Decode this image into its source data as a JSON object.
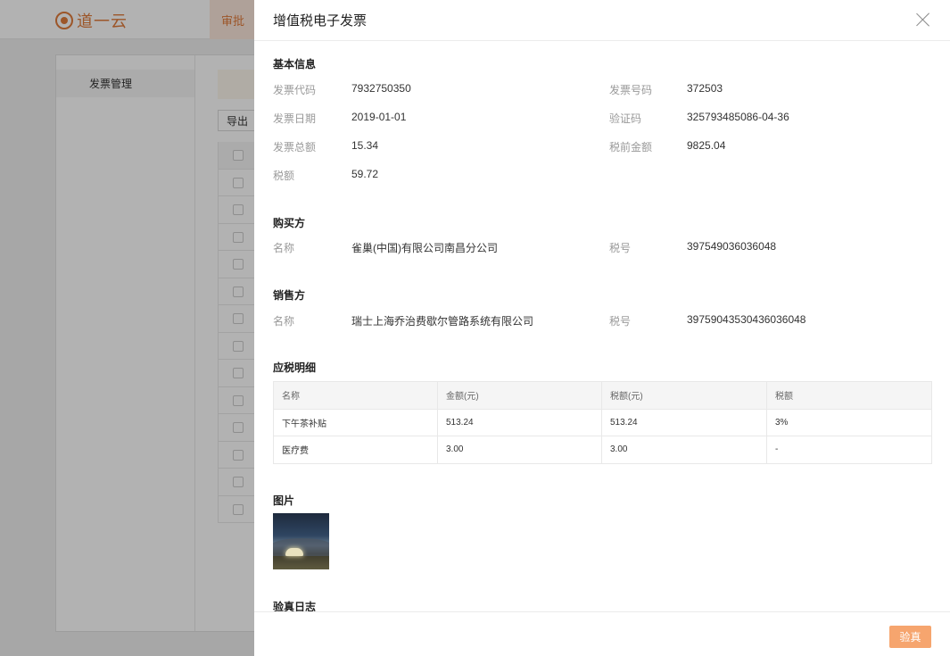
{
  "app": {
    "logo_text": "道一云",
    "nav_tab": "审批",
    "sidebar_item": "发票管理",
    "export_label": "导出"
  },
  "drawer": {
    "title": "增值税电子发票",
    "basic": {
      "title": "基本信息",
      "invoice_code_label": "发票代码",
      "invoice_code": "7932750350",
      "invoice_no_label": "发票号码",
      "invoice_no": "372503",
      "date_label": "发票日期",
      "date": "2019-01-01",
      "check_code_label": "验证码",
      "check_code": "325793485086-04-36",
      "total_label": "发票总额",
      "total": "15.34",
      "pretax_label": "税前金额",
      "pretax": "9825.04",
      "tax_label": "税额",
      "tax": "59.72"
    },
    "buyer": {
      "title": "购买方",
      "name_label": "名称",
      "name": "雀巢(中国)有限公司南昌分公司",
      "taxno_label": "税号",
      "taxno": "397549036036048"
    },
    "seller": {
      "title": "销售方",
      "name_label": "名称",
      "name": "瑞士上海乔治费歇尔管路系统有限公司",
      "taxno_label": "税号",
      "taxno": "397590435304360360 48"
    },
    "details": {
      "title": "应税明细",
      "columns": [
        "名称",
        "金额(元)",
        "税额(元)",
        "税额"
      ],
      "rows": [
        [
          "下午茶补贴",
          "513.24",
          "513.24",
          "3%"
        ],
        [
          "医疗费",
          "3.00",
          "3.00",
          "-"
        ]
      ]
    },
    "image_section_title": "图片",
    "log_section_title": "验真日志",
    "verify_button": "验真"
  },
  "colors": {
    "brand": "#e07b3c",
    "verify_button": "#f6a56e"
  }
}
